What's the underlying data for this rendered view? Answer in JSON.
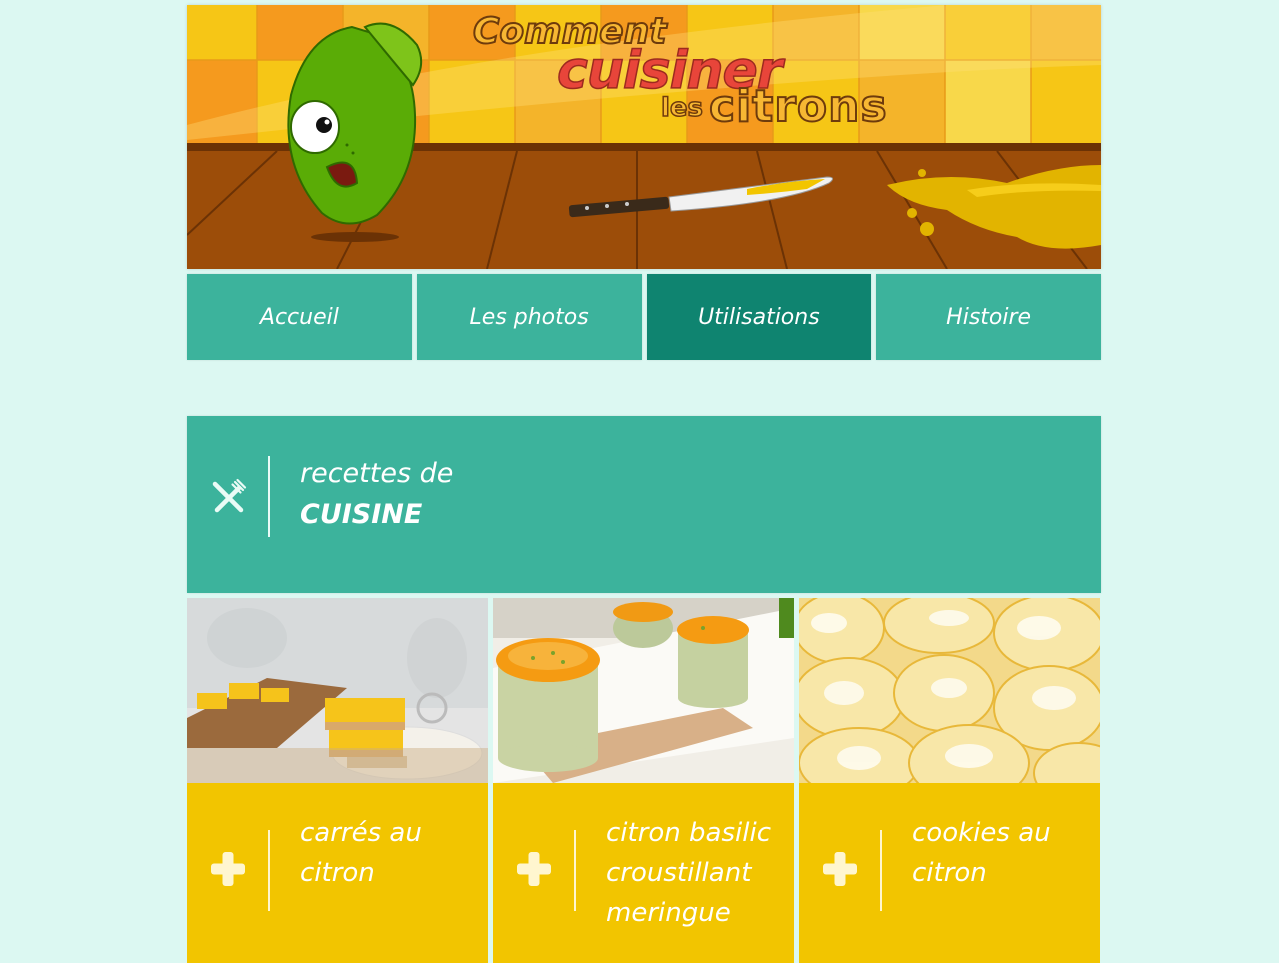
{
  "header": {
    "logo": {
      "line1": "Comment",
      "line2": "cuisiner",
      "line3_small": "les",
      "line3_big": "citrons"
    }
  },
  "nav": {
    "items": [
      {
        "label": "Accueil",
        "active": false
      },
      {
        "label": "Les photos",
        "active": false
      },
      {
        "label": "Utilisations",
        "active": true
      },
      {
        "label": "Histoire",
        "active": false
      }
    ]
  },
  "section": {
    "icon": "fork-knife-icon",
    "subtitle": "recettes de",
    "title": "CUISINE"
  },
  "recipes": [
    {
      "title": "carrés au citron",
      "icon": "plus-icon"
    },
    {
      "title": "citron basilic croustillant meringue",
      "icon": "plus-icon"
    },
    {
      "title": "cookies au citron",
      "icon": "plus-icon"
    }
  ],
  "colors": {
    "page_bg": "#dcf8f2",
    "teal": "#3cb39c",
    "teal_active": "#0f8470",
    "yellow": "#f2c500"
  }
}
